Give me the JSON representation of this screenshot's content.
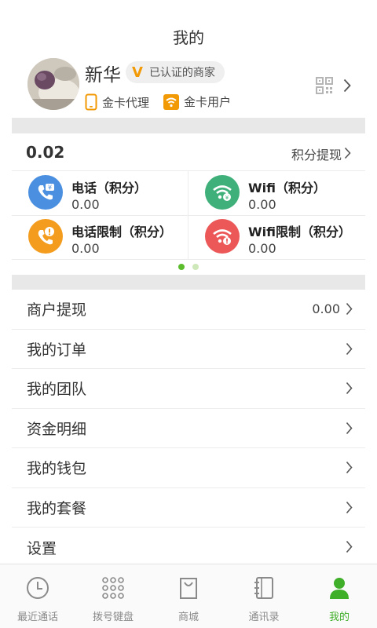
{
  "header": {
    "title": "我的"
  },
  "profile": {
    "name": "新华",
    "certified_label": "已认证的商家",
    "certified_badge": "V",
    "roles": [
      {
        "label": "金卡代理",
        "icon": "phone-icon"
      },
      {
        "label": "金卡用户",
        "icon": "wifi-icon"
      }
    ]
  },
  "points": {
    "amount": "0.02",
    "withdraw_label": "积分提现"
  },
  "point_cards": [
    {
      "label": "电话（积分）",
      "value": "0.00",
      "icon": "phone-points-icon",
      "color": "#4a8fe0"
    },
    {
      "label": "Wifi（积分）",
      "value": "0.00",
      "icon": "wifi-points-icon",
      "color": "#3fb07a"
    },
    {
      "label": "电话限制（积分）",
      "value": "0.00",
      "icon": "phone-limit-icon",
      "color": "#f39c1e"
    },
    {
      "label": "Wifi限制（积分）",
      "value": "0.00",
      "icon": "wifi-limit-icon",
      "color": "#ec5757"
    }
  ],
  "menu": [
    {
      "label": "商户提现",
      "value": "0.00"
    },
    {
      "label": "我的订单"
    },
    {
      "label": "我的团队"
    },
    {
      "label": "资金明细"
    },
    {
      "label": "我的钱包"
    },
    {
      "label": "我的套餐"
    },
    {
      "label": "设置"
    }
  ],
  "tabs": [
    {
      "label": "最近通话",
      "icon": "clock-icon"
    },
    {
      "label": "拨号键盘",
      "icon": "keypad-icon"
    },
    {
      "label": "商城",
      "icon": "shopping-bag-icon"
    },
    {
      "label": "通讯录",
      "icon": "contacts-icon"
    },
    {
      "label": "我的",
      "icon": "person-icon",
      "active": true
    }
  ],
  "colors": {
    "accent": "#3fae29",
    "badge": "#f29a05"
  }
}
